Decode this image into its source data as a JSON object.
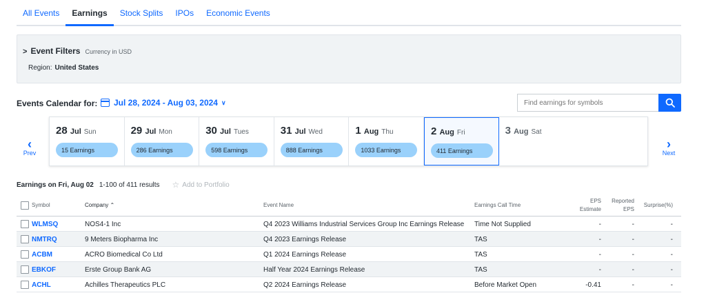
{
  "tabs": [
    {
      "label": "All Events",
      "active": false
    },
    {
      "label": "Earnings",
      "active": true
    },
    {
      "label": "Stock Splits",
      "active": false
    },
    {
      "label": "IPOs",
      "active": false
    },
    {
      "label": "Economic Events",
      "active": false
    }
  ],
  "filters": {
    "title": "Event Filters",
    "currency": "Currency in USD",
    "region_label": "Region:",
    "region_value": "United States"
  },
  "calendar": {
    "label": "Events Calendar for:",
    "range": "Jul 28, 2024 - Aug 03, 2024",
    "search_placeholder": "Find earnings for symbols",
    "prev": "Prev",
    "next": "Next",
    "days": [
      {
        "day": "28",
        "month": "Jul",
        "dow": "Sun",
        "pill": "15 Earnings"
      },
      {
        "day": "29",
        "month": "Jul",
        "dow": "Mon",
        "pill": "286 Earnings"
      },
      {
        "day": "30",
        "month": "Jul",
        "dow": "Tues",
        "pill": "598 Earnings"
      },
      {
        "day": "31",
        "month": "Jul",
        "dow": "Wed",
        "pill": "888 Earnings"
      },
      {
        "day": "1",
        "month": "Aug",
        "dow": "Thu",
        "pill": "1033 Earnings"
      },
      {
        "day": "2",
        "month": "Aug",
        "dow": "Fri",
        "pill": "411 Earnings"
      },
      {
        "day": "3",
        "month": "Aug",
        "dow": "Sat",
        "pill": ""
      }
    ]
  },
  "results": {
    "title": "Earnings on Fri, Aug 02",
    "count": "1-100 of 411 results",
    "portfolio": "Add to Portfolio"
  },
  "table": {
    "headers": {
      "symbol": "Symbol",
      "company": "Company",
      "event": "Event Name",
      "call_time": "Earnings Call Time",
      "eps_est_1": "EPS",
      "eps_est_2": "Estimate",
      "eps_rep_1": "Reported",
      "eps_rep_2": "EPS",
      "surprise": "Surprise(%)"
    },
    "rows": [
      {
        "symbol": "WLMSQ",
        "company": "NOS4-1 Inc",
        "event": "Q4 2023 Williams Industrial Services Group Inc Earnings Release",
        "call_time": "Time Not Supplied",
        "eps_est": "-",
        "eps_rep": "-",
        "surprise": "-"
      },
      {
        "symbol": "NMTRQ",
        "company": "9 Meters Biopharma Inc",
        "event": "Q4 2023 Earnings Release",
        "call_time": "TAS",
        "eps_est": "-",
        "eps_rep": "-",
        "surprise": "-"
      },
      {
        "symbol": "ACBM",
        "company": "ACRO Biomedical Co Ltd",
        "event": "Q1 2024 Earnings Release",
        "call_time": "TAS",
        "eps_est": "-",
        "eps_rep": "-",
        "surprise": "-"
      },
      {
        "symbol": "EBKOF",
        "company": "Erste Group Bank AG",
        "event": "Half Year 2024 Earnings Release",
        "call_time": "TAS",
        "eps_est": "-",
        "eps_rep": "-",
        "surprise": "-"
      },
      {
        "symbol": "ACHL",
        "company": "Achilles Therapeutics PLC",
        "event": "Q2 2024 Earnings Release",
        "call_time": "Before Market Open",
        "eps_est": "-0.41",
        "eps_rep": "-",
        "surprise": "-"
      }
    ]
  },
  "colors": {
    "accent": "#0f69ff",
    "pill": "#9ad1fb",
    "panel": "#f0f3f5"
  }
}
